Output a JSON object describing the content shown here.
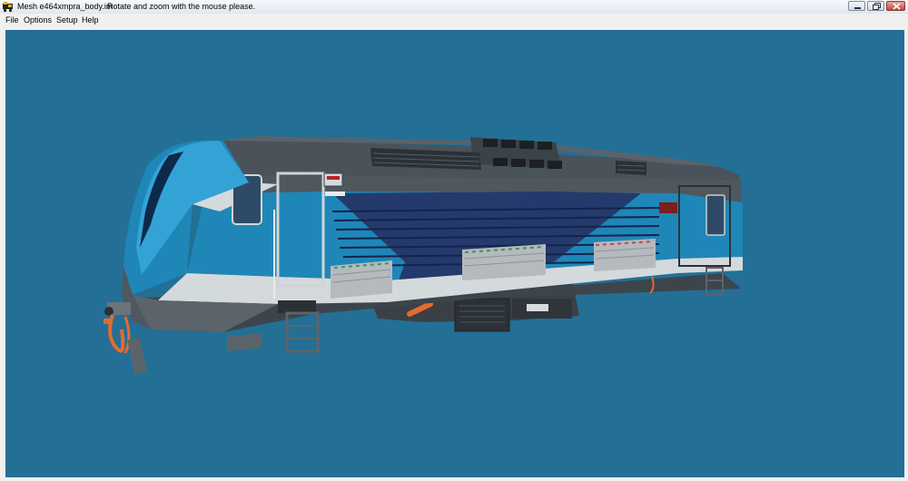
{
  "window": {
    "title": "Mesh e464xmpra_body.im",
    "hint": "Rotate and zoom with the mouse please.",
    "app_icon": "locomotive-icon",
    "controls": {
      "minimize": "minimize-icon",
      "maximize": "restore-icon",
      "close": "close-icon"
    }
  },
  "menu": {
    "items": [
      "File",
      "Options",
      "Setup",
      "Help"
    ]
  },
  "viewport": {
    "background": "#236f96",
    "model": "3D locomotive body mesh",
    "colors": {
      "roof": "#4a525a",
      "blue": "#1f86b8",
      "light_blue": "#33a3d6",
      "dark_blue": "#253a6c",
      "white_band": "#d4d9dc",
      "frame": "#3d454c",
      "orange": "#e46b2b"
    }
  }
}
